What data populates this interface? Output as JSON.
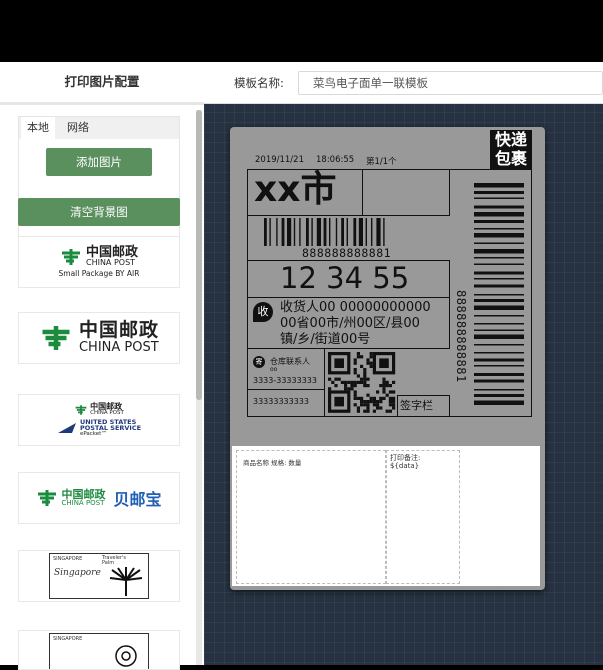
{
  "sidebar": {
    "title": "打印图片配置",
    "tabs": [
      "本地",
      "网络"
    ],
    "add_button": "添加图片",
    "clear_button": "清空背景图",
    "thumbnails": [
      {
        "name": "china-post-small-package",
        "cn": "中国邮政",
        "en": "CHINA POST",
        "sub": "Small Package BY AIR"
      },
      {
        "name": "china-post",
        "cn": "中国邮政",
        "en": "CHINA POST"
      },
      {
        "name": "china-post-usps",
        "cn": "中国邮政",
        "en": "CHINA POST",
        "us1": "UNITED STATES",
        "us2": "POSTAL SERVICE",
        "us3": "ePacket™"
      },
      {
        "name": "china-post-beiyoubao",
        "cn": "中国邮政",
        "en": "CHINA POST",
        "brand": "贝邮宝"
      },
      {
        "name": "singapore-post-palm",
        "country": "SINGAPORE",
        "caption1": "Traveler's",
        "caption2": "Palm"
      },
      {
        "name": "singapore-post-orchid",
        "country": "SINGAPORE"
      }
    ]
  },
  "header": {
    "template_label": "模板名称:",
    "template_name": "菜鸟电子面单一联模板"
  },
  "label": {
    "badge_top": "快递",
    "badge_bottom": "包裹",
    "date": "2019/11/21",
    "time": "18:06:55",
    "page": "第1/1个",
    "city": "xx市",
    "barcode_number": "888888888881",
    "sort_code": "12 34 55",
    "recipient_icon": "收",
    "recipient_line1": "收货人00   00000000000",
    "recipient_line2": "00省00市/州00区/县00",
    "recipient_line3": "镇/乡/街道00号",
    "side_barcode_number": "888888888881",
    "warehouse_icon": "寄",
    "warehouse_label": "仓库联系人",
    "warehouse_sub": "oo",
    "warehouse_phone": "3333-33333333",
    "warehouse_phone2": "33333333333",
    "signature": "签字栏",
    "goods_label": "商品名称  规格:   数量",
    "print_remark_label": "打印备注:",
    "print_remark_value": "${data}"
  },
  "colors": {
    "green_button": "#5a8f5e",
    "canvas_bg": "#263241",
    "label_gray": "#999999"
  }
}
